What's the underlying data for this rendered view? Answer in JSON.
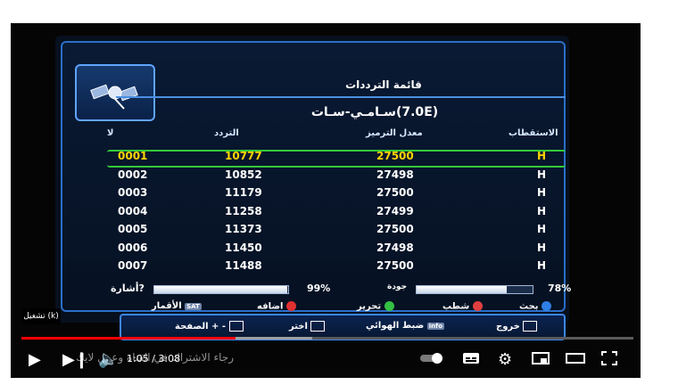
{
  "receiver": {
    "title": "قائمة الترددات",
    "satellite": "سـامـي-سـات(7.0E)",
    "columns": {
      "no": "لا",
      "freq": "التردد",
      "symbol_rate": "معدل الترميز",
      "polarization": "الاستقطاب"
    },
    "rows": [
      {
        "no": "0001",
        "freq": "10777",
        "sr": "27500",
        "pol": "H"
      },
      {
        "no": "0002",
        "freq": "10852",
        "sr": "27498",
        "pol": "H"
      },
      {
        "no": "0003",
        "freq": "11179",
        "sr": "27500",
        "pol": "H"
      },
      {
        "no": "0004",
        "freq": "11258",
        "sr": "27499",
        "pol": "H"
      },
      {
        "no": "0005",
        "freq": "11373",
        "sr": "27500",
        "pol": "H"
      },
      {
        "no": "0006",
        "freq": "11450",
        "sr": "27498",
        "pol": "H"
      },
      {
        "no": "0007",
        "freq": "11488",
        "sr": "27500",
        "pol": "H"
      }
    ],
    "signal": {
      "label": "أشارة?",
      "value": "99%",
      "fraction": 0.99
    },
    "quality": {
      "label": "جودة",
      "value": "78%",
      "fraction": 0.78
    },
    "legend": {
      "satellites": "الأقمار",
      "satellites_key": "SAT",
      "add": "اضافه",
      "edit": "تحرير",
      "delete": "شطب",
      "search": "بحث"
    },
    "footer": {
      "page": "الصفحة + -",
      "select": "اختر",
      "antenna": "ضبط الهوائي",
      "antenna_key": "info",
      "exit": "خروج"
    }
  },
  "player": {
    "badge": "تشغيل (k)",
    "time": "1:05 / 3:08",
    "overlay_text": "رجاء الاشتراك في القناة وعمل لايك",
    "progress_fraction": 0.35,
    "buffer_fraction": 0.475
  }
}
